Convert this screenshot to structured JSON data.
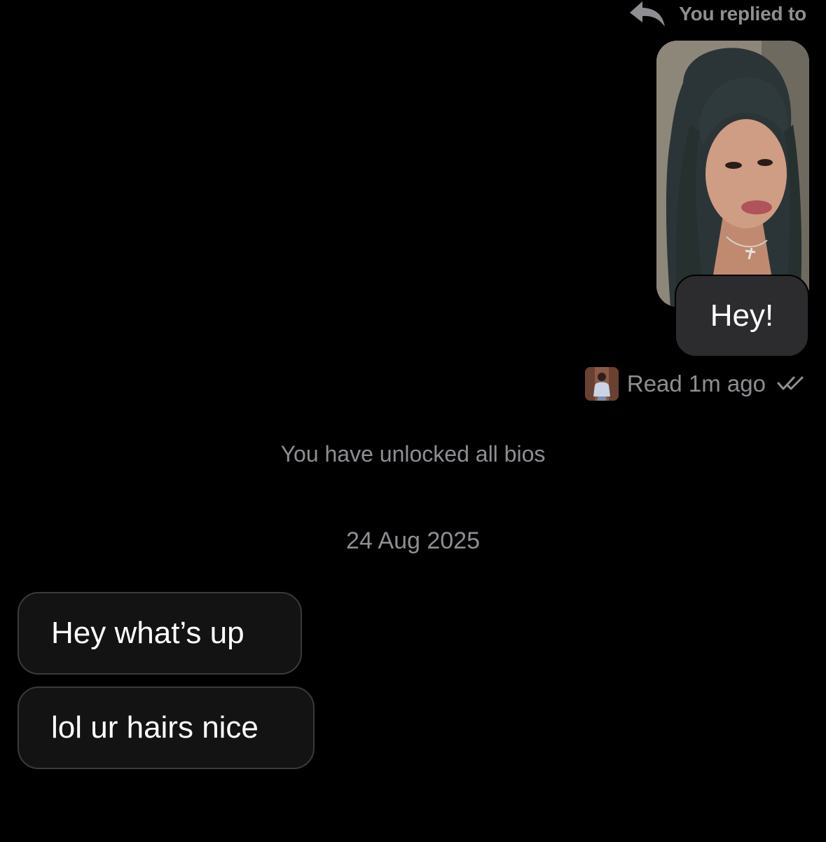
{
  "reply_header": {
    "label": "You replied to",
    "icon": "reply-arrow-icon"
  },
  "replied_photo": {
    "description_icon": "photo-thumbnail"
  },
  "outgoing_message": {
    "text": "Hey!"
  },
  "read_receipt": {
    "text": "Read 1m ago",
    "icon": "double-check-icon"
  },
  "system_notice": {
    "unlocked_text": "You have unlocked all bios"
  },
  "date_separator": {
    "text": "24 Aug 2025"
  },
  "incoming_messages": [
    {
      "text": "Hey what’s up"
    },
    {
      "text": "lol ur hairs nice"
    }
  ],
  "colors": {
    "background": "#000000",
    "outgoing_bubble": "#2c2c2e",
    "incoming_bubble": "#131313",
    "incoming_border": "#3a3a3c",
    "muted_text": "#8e8e93"
  }
}
